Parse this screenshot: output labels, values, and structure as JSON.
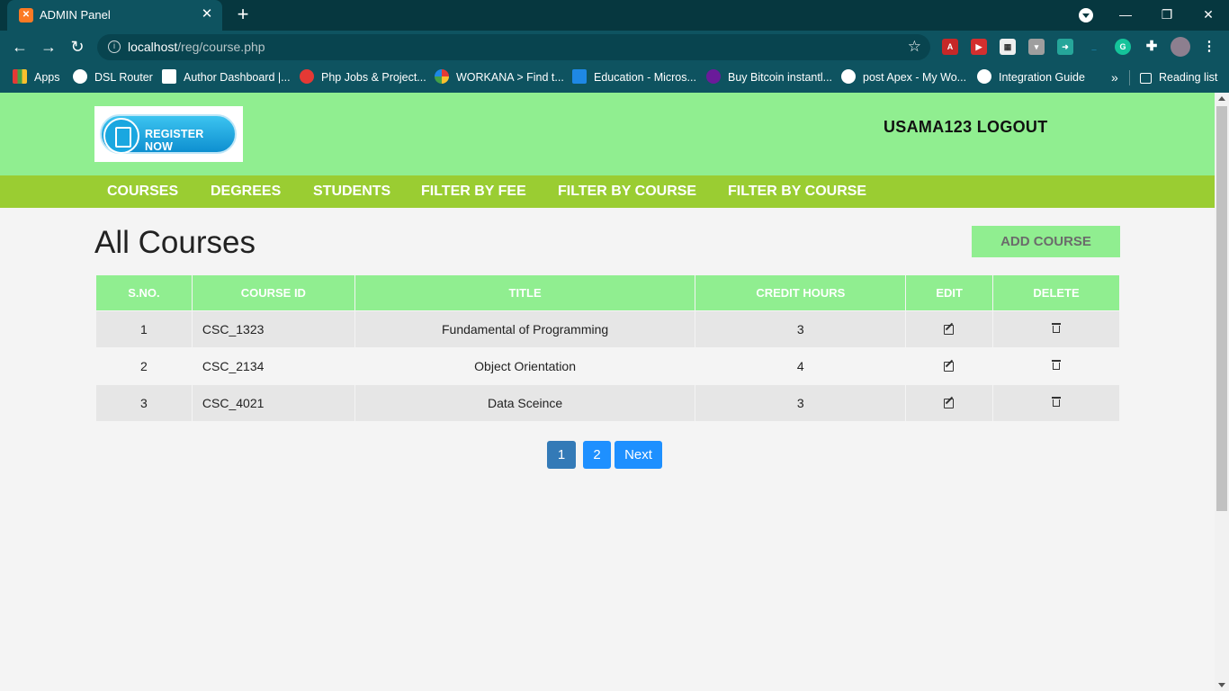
{
  "browser": {
    "tab_title": "ADMIN Panel",
    "tab_favicon": "xampp-icon",
    "url_host": "localhost",
    "url_path": "/reg/course.php",
    "bookmarks": [
      {
        "label": "Apps",
        "icon": "apps-grid-icon"
      },
      {
        "label": "DSL Router",
        "icon": "globe-icon"
      },
      {
        "label": "Author Dashboard |...",
        "icon": "author-icon"
      },
      {
        "label": "Php Jobs & Project...",
        "icon": "php-jobs-icon"
      },
      {
        "label": "WORKANA > Find t...",
        "icon": "workana-icon"
      },
      {
        "label": "Education - Micros...",
        "icon": "azure-icon"
      },
      {
        "label": "Buy Bitcoin instantl...",
        "icon": "bitcoin-icon"
      },
      {
        "label": "post Apex - My Wo...",
        "icon": "globe-icon"
      },
      {
        "label": "Integration Guide",
        "icon": "globe-icon"
      }
    ],
    "overflow_label": "»",
    "reading_list": "Reading list"
  },
  "header": {
    "logo_text": "REGISTER NOW",
    "user_logout": "USAMA123 LOGOUT"
  },
  "nav": [
    "COURSES",
    "DEGREES",
    "STUDENTS",
    "FILTER BY FEE",
    "FILTER BY COURSE",
    "FILTER BY COURSE"
  ],
  "main": {
    "title": "All Courses",
    "add_button": "ADD COURSE",
    "columns": [
      "S.NO.",
      "COURSE ID",
      "TITLE",
      "CREDIT HOURS",
      "EDIT",
      "DELETE"
    ],
    "rows": [
      {
        "sno": "1",
        "course_id": "CSC_1323",
        "title": "Fundamental of Programming",
        "credit_hours": "3"
      },
      {
        "sno": "2",
        "course_id": "CSC_2134",
        "title": "Object Orientation",
        "credit_hours": "4"
      },
      {
        "sno": "3",
        "course_id": "CSC_4021",
        "title": "Data Sceince",
        "credit_hours": "3"
      }
    ],
    "pagination": {
      "page1": "1",
      "page2": "2",
      "next": "Next"
    }
  },
  "colors": {
    "header_bg": "#90ee90",
    "nav_bg": "#9acd32",
    "pager_active": "#337ab7",
    "pager_link": "#1e90ff"
  }
}
